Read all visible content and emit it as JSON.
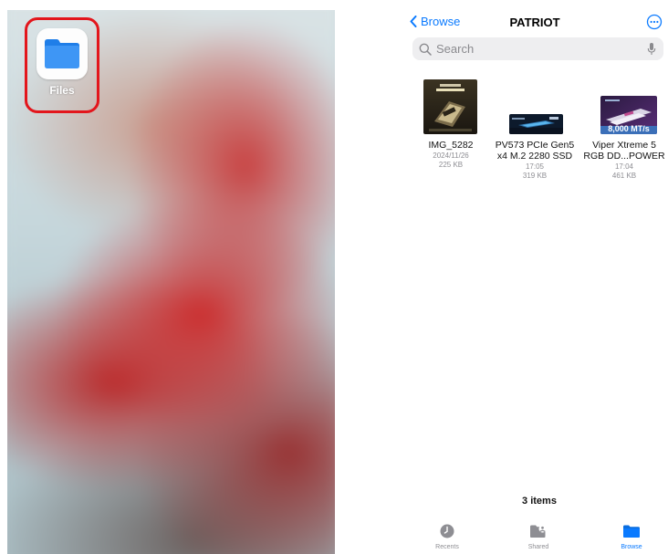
{
  "home_screen": {
    "app_label": "Files"
  },
  "files_app": {
    "nav": {
      "back_label": "Browse",
      "title": "PATRIOT"
    },
    "search": {
      "placeholder": "Search"
    },
    "files": [
      {
        "name_line1": "IMG_5282",
        "name_line2": "",
        "date": "2024/11/26",
        "size": "225 KB",
        "thumb_overlay": ""
      },
      {
        "name_line1": "PV573 PCIe Gen5",
        "name_line2": "x4 M.2 2280 SSD",
        "date": "17:05",
        "size": "319 KB",
        "thumb_overlay": ""
      },
      {
        "name_line1": "Viper Xtreme 5",
        "name_line2": "RGB DD...POWER",
        "date": "17:04",
        "size": "461 KB",
        "thumb_overlay": "8,000 MT/s"
      }
    ],
    "item_count": "3 items",
    "tabs": [
      {
        "label": "Recents",
        "icon": "clock-icon",
        "active": false
      },
      {
        "label": "Shared",
        "icon": "shared-folder-icon",
        "active": false
      },
      {
        "label": "Browse",
        "icon": "folder-icon",
        "active": true
      }
    ],
    "colors": {
      "accent": "#0a7aff",
      "highlight_ring": "#e3161c",
      "secondary_text": "#8e8e93"
    }
  }
}
